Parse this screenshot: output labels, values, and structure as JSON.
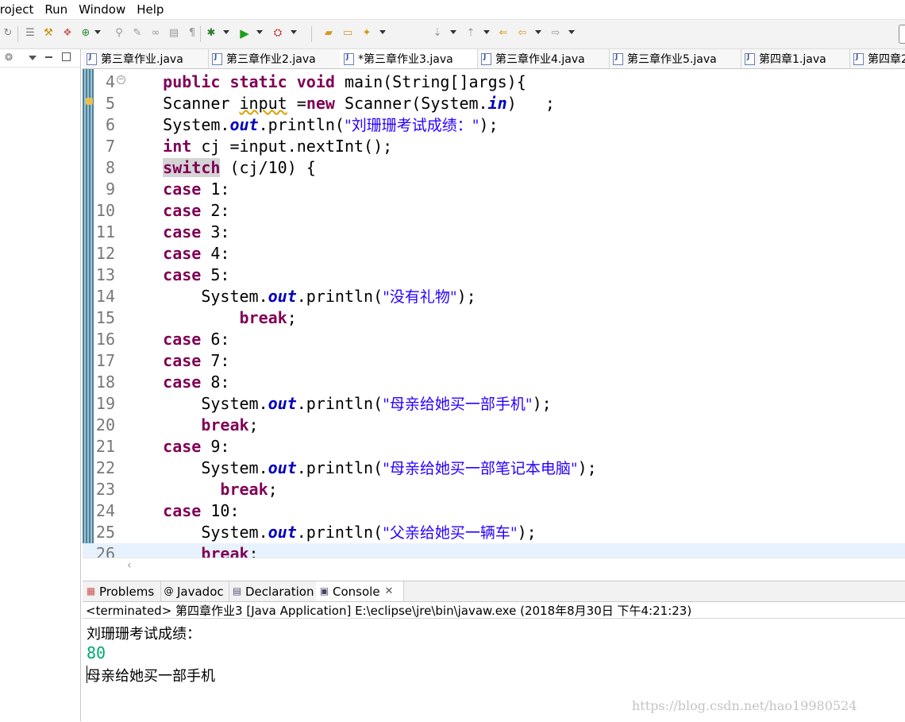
{
  "menu": [
    "Project",
    "Run",
    "Window",
    "Help"
  ],
  "editor_tabs": [
    {
      "label": "第三章作业.java"
    },
    {
      "label": "第三章作业2.java"
    },
    {
      "label": "*第三章作业3.java"
    },
    {
      "label": "第三章作业4.java"
    },
    {
      "label": "第三章作业5.java"
    },
    {
      "label": "第四章1.java"
    },
    {
      "label": "第四章2"
    }
  ],
  "code_lines": [
    {
      "n": "4",
      "parts": [
        {
          "t": "    "
        },
        {
          "t": "public",
          "c": "kw"
        },
        {
          "t": " "
        },
        {
          "t": "static",
          "c": "kw"
        },
        {
          "t": " "
        },
        {
          "t": "void",
          "c": "kw"
        },
        {
          "t": " main(String[]args){"
        }
      ]
    },
    {
      "n": "5",
      "parts": [
        {
          "t": "    Scanner "
        },
        {
          "t": "input",
          "c": "warn"
        },
        {
          "t": " ="
        },
        {
          "t": "new",
          "c": "kw"
        },
        {
          "t": " Scanner(System."
        },
        {
          "t": "in",
          "c": "fld"
        },
        {
          "t": ")   ;"
        }
      ]
    },
    {
      "n": "6",
      "parts": [
        {
          "t": "    System."
        },
        {
          "t": "out",
          "c": "fld"
        },
        {
          "t": ".println("
        },
        {
          "t": "\"刘珊珊考试成绩：\"",
          "c": "st"
        },
        {
          "t": ");"
        }
      ]
    },
    {
      "n": "7",
      "parts": [
        {
          "t": "    "
        },
        {
          "t": "int",
          "c": "kw"
        },
        {
          "t": " cj =input.nextInt();"
        }
      ]
    },
    {
      "n": "8",
      "parts": [
        {
          "t": "    "
        },
        {
          "t": "switch",
          "c": "kw kwhl"
        },
        {
          "t": " (cj/10) {"
        }
      ]
    },
    {
      "n": "9",
      "parts": [
        {
          "t": "    "
        },
        {
          "t": "case",
          "c": "kw"
        },
        {
          "t": " 1:"
        }
      ]
    },
    {
      "n": "10",
      "parts": [
        {
          "t": "    "
        },
        {
          "t": "case",
          "c": "kw"
        },
        {
          "t": " 2:"
        }
      ]
    },
    {
      "n": "11",
      "parts": [
        {
          "t": "    "
        },
        {
          "t": "case",
          "c": "kw"
        },
        {
          "t": " 3:"
        }
      ]
    },
    {
      "n": "12",
      "parts": [
        {
          "t": "    "
        },
        {
          "t": "case",
          "c": "kw"
        },
        {
          "t": " 4:"
        }
      ]
    },
    {
      "n": "13",
      "parts": [
        {
          "t": "    "
        },
        {
          "t": "case",
          "c": "kw"
        },
        {
          "t": " 5:"
        }
      ]
    },
    {
      "n": "14",
      "parts": [
        {
          "t": "        System."
        },
        {
          "t": "out",
          "c": "fld"
        },
        {
          "t": ".println("
        },
        {
          "t": "\"没有礼物\"",
          "c": "st"
        },
        {
          "t": ");"
        }
      ]
    },
    {
      "n": "15",
      "parts": [
        {
          "t": "            "
        },
        {
          "t": "break",
          "c": "kw"
        },
        {
          "t": ";"
        }
      ]
    },
    {
      "n": "16",
      "parts": [
        {
          "t": "    "
        },
        {
          "t": "case",
          "c": "kw"
        },
        {
          "t": " 6:"
        }
      ]
    },
    {
      "n": "17",
      "parts": [
        {
          "t": "    "
        },
        {
          "t": "case",
          "c": "kw"
        },
        {
          "t": " 7:"
        }
      ]
    },
    {
      "n": "18",
      "parts": [
        {
          "t": "    "
        },
        {
          "t": "case",
          "c": "kw"
        },
        {
          "t": " 8:"
        }
      ]
    },
    {
      "n": "19",
      "parts": [
        {
          "t": "        System."
        },
        {
          "t": "out",
          "c": "fld"
        },
        {
          "t": ".println("
        },
        {
          "t": "\"母亲给她买一部手机\"",
          "c": "st"
        },
        {
          "t": ");"
        }
      ]
    },
    {
      "n": "20",
      "parts": [
        {
          "t": "        "
        },
        {
          "t": "break",
          "c": "kw"
        },
        {
          "t": ";"
        }
      ]
    },
    {
      "n": "21",
      "parts": [
        {
          "t": "    "
        },
        {
          "t": "case",
          "c": "kw"
        },
        {
          "t": " 9:"
        }
      ]
    },
    {
      "n": "22",
      "parts": [
        {
          "t": "        System."
        },
        {
          "t": "out",
          "c": "fld"
        },
        {
          "t": ".println("
        },
        {
          "t": "\"母亲给她买一部笔记本电脑\"",
          "c": "st"
        },
        {
          "t": ");"
        }
      ]
    },
    {
      "n": "23",
      "parts": [
        {
          "t": "          "
        },
        {
          "t": "break",
          "c": "kw"
        },
        {
          "t": ";"
        }
      ]
    },
    {
      "n": "24",
      "parts": [
        {
          "t": "    "
        },
        {
          "t": "case",
          "c": "kw"
        },
        {
          "t": " 10:"
        }
      ]
    },
    {
      "n": "25",
      "parts": [
        {
          "t": "        System."
        },
        {
          "t": "out",
          "c": "fld"
        },
        {
          "t": ".println("
        },
        {
          "t": "\"父亲给她买一辆车\"",
          "c": "st"
        },
        {
          "t": ");"
        }
      ]
    },
    {
      "n": "26",
      "parts": [
        {
          "t": "        "
        },
        {
          "t": "break",
          "c": "kw"
        },
        {
          "t": ";"
        }
      ]
    }
  ],
  "console_tabs": [
    {
      "label": "Problems",
      "icon": "problems-icon"
    },
    {
      "label": "Javadoc",
      "icon": "at-icon"
    },
    {
      "label": "Declaration",
      "icon": "declaration-icon"
    },
    {
      "label": "Console",
      "icon": "console-icon"
    }
  ],
  "console": {
    "status": "<terminated> 第四章作业3 [Java Application] E:\\eclipse\\jre\\bin\\javaw.exe (2018年8月30日 下午4:21:23)",
    "out1": "刘珊珊考试成绩：",
    "input": "80",
    "out2": "母亲给她买一部手机"
  },
  "watermark": "https://blog.csdn.net/hao19980524",
  "colors": {
    "keyword": "#7f0055",
    "string": "#2a00ff",
    "field": "#0000c0",
    "console_input": "#00a870"
  }
}
